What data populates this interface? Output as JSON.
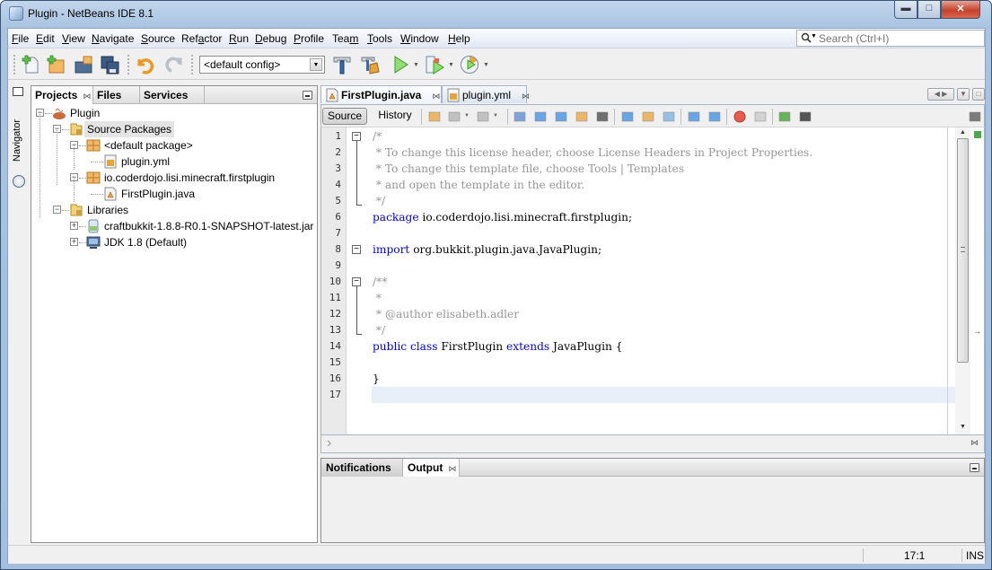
{
  "window": {
    "title": "Plugin - NetBeans IDE 8.1",
    "controls": {
      "minimize": "minimize",
      "maximize": "maximize",
      "close": "close"
    }
  },
  "menubar": {
    "items": [
      {
        "label": "File",
        "mnemonic": "F"
      },
      {
        "label": "Edit",
        "mnemonic": "E"
      },
      {
        "label": "View",
        "mnemonic": "V"
      },
      {
        "label": "Navigate",
        "mnemonic": "N"
      },
      {
        "label": "Source",
        "mnemonic": "S"
      },
      {
        "label": "Refactor",
        "mnemonic": "a"
      },
      {
        "label": "Run",
        "mnemonic": "R"
      },
      {
        "label": "Debug",
        "mnemonic": "D"
      },
      {
        "label": "Profile",
        "mnemonic": "P"
      },
      {
        "label": "Team",
        "mnemonic": "m"
      },
      {
        "label": "Tools",
        "mnemonic": "T"
      },
      {
        "label": "Window",
        "mnemonic": "W"
      },
      {
        "label": "Help",
        "mnemonic": "H"
      }
    ],
    "search": {
      "placeholder": "Search (Ctrl+I)",
      "value": ""
    }
  },
  "toolbar": {
    "buttons": [
      "new-file",
      "new-project",
      "open-project",
      "save-all",
      "undo",
      "redo",
      "build",
      "clean-build",
      "run",
      "debug",
      "profile"
    ],
    "config": {
      "selected": "<default config>"
    }
  },
  "navigator": {
    "label": "Navigator"
  },
  "projects_panel": {
    "tabs": [
      {
        "label": "Projects",
        "active": true,
        "closable": true
      },
      {
        "label": "Files",
        "active": false
      },
      {
        "label": "Services",
        "active": false
      }
    ],
    "tree": [
      {
        "label": "Plugin",
        "type": "project",
        "level": 0,
        "expanded": true
      },
      {
        "label": "Source Packages",
        "type": "source-folder",
        "level": 1,
        "expanded": true,
        "selected": true
      },
      {
        "label": "<default package>",
        "type": "package",
        "level": 2,
        "expanded": true
      },
      {
        "label": "plugin.yml",
        "type": "yml-file",
        "level": 3
      },
      {
        "label": "io.coderdojo.lisi.minecraft.firstplugin",
        "type": "package",
        "level": 2,
        "expanded": true
      },
      {
        "label": "FirstPlugin.java",
        "type": "java-file",
        "level": 3
      },
      {
        "label": "Libraries",
        "type": "library-folder",
        "level": 1,
        "expanded": true
      },
      {
        "label": "craftbukkit-1.8.8-R0.1-SNAPSHOT-latest.jar",
        "type": "jar",
        "level": 2,
        "expanded": false
      },
      {
        "label": "JDK 1.8 (Default)",
        "type": "jdk",
        "level": 2,
        "expanded": false
      }
    ]
  },
  "editor": {
    "tabs": [
      {
        "label": "FirstPlugin.java",
        "active": true
      },
      {
        "label": "plugin.yml",
        "active": false
      }
    ],
    "source_label": "Source",
    "history_label": "History",
    "lines": [
      {
        "n": "1",
        "parts": [
          {
            "t": "/*",
            "c": "cm"
          }
        ]
      },
      {
        "n": "2",
        "parts": [
          {
            "t": " * To change this license header, choose License Headers in Project Properties.",
            "c": "cm"
          }
        ]
      },
      {
        "n": "3",
        "parts": [
          {
            "t": " * To change this template file, choose Tools | Templates",
            "c": "cm"
          }
        ]
      },
      {
        "n": "4",
        "parts": [
          {
            "t": " * and open the template in the editor.",
            "c": "cm"
          }
        ]
      },
      {
        "n": "5",
        "parts": [
          {
            "t": " */",
            "c": "cm"
          }
        ]
      },
      {
        "n": "6",
        "parts": [
          {
            "t": "package",
            "c": "kw"
          },
          {
            "t": " io.coderdojo.lisi.minecraft.firstplugin;",
            "c": ""
          }
        ]
      },
      {
        "n": "7",
        "parts": []
      },
      {
        "n": "8",
        "parts": [
          {
            "t": "import",
            "c": "kw"
          },
          {
            "t": " org.bukkit.plugin.java.JavaPlugin;",
            "c": ""
          }
        ]
      },
      {
        "n": "9",
        "parts": []
      },
      {
        "n": "10",
        "parts": [
          {
            "t": "/**",
            "c": "cm"
          }
        ]
      },
      {
        "n": "11",
        "parts": [
          {
            "t": " *",
            "c": "cm"
          }
        ]
      },
      {
        "n": "12",
        "parts": [
          {
            "t": " * @author elisabeth.adler",
            "c": "cm"
          }
        ]
      },
      {
        "n": "13",
        "parts": [
          {
            "t": " */",
            "c": "cm"
          }
        ]
      },
      {
        "n": "14",
        "parts": [
          {
            "t": "public",
            "c": "kw"
          },
          {
            "t": " ",
            "c": ""
          },
          {
            "t": "class",
            "c": "kw"
          },
          {
            "t": " FirstPlugin ",
            "c": ""
          },
          {
            "t": "extends",
            "c": "kw"
          },
          {
            "t": " JavaPlugin {",
            "c": ""
          }
        ]
      },
      {
        "n": "15",
        "parts": []
      },
      {
        "n": "16",
        "parts": [
          {
            "t": "}",
            "c": ""
          }
        ]
      },
      {
        "n": "17",
        "parts": []
      }
    ],
    "current_line": 17
  },
  "output_panel": {
    "tabs": [
      {
        "label": "Notifications",
        "active": false
      },
      {
        "label": "Output",
        "active": true,
        "closable": true
      }
    ]
  },
  "statusbar": {
    "position": "17:1",
    "mode": "INS"
  },
  "colors": {
    "keyword": "#0000e6",
    "comment": "#969696",
    "current_line": "#e9eff8",
    "ok_mark": "#4caa4c"
  }
}
